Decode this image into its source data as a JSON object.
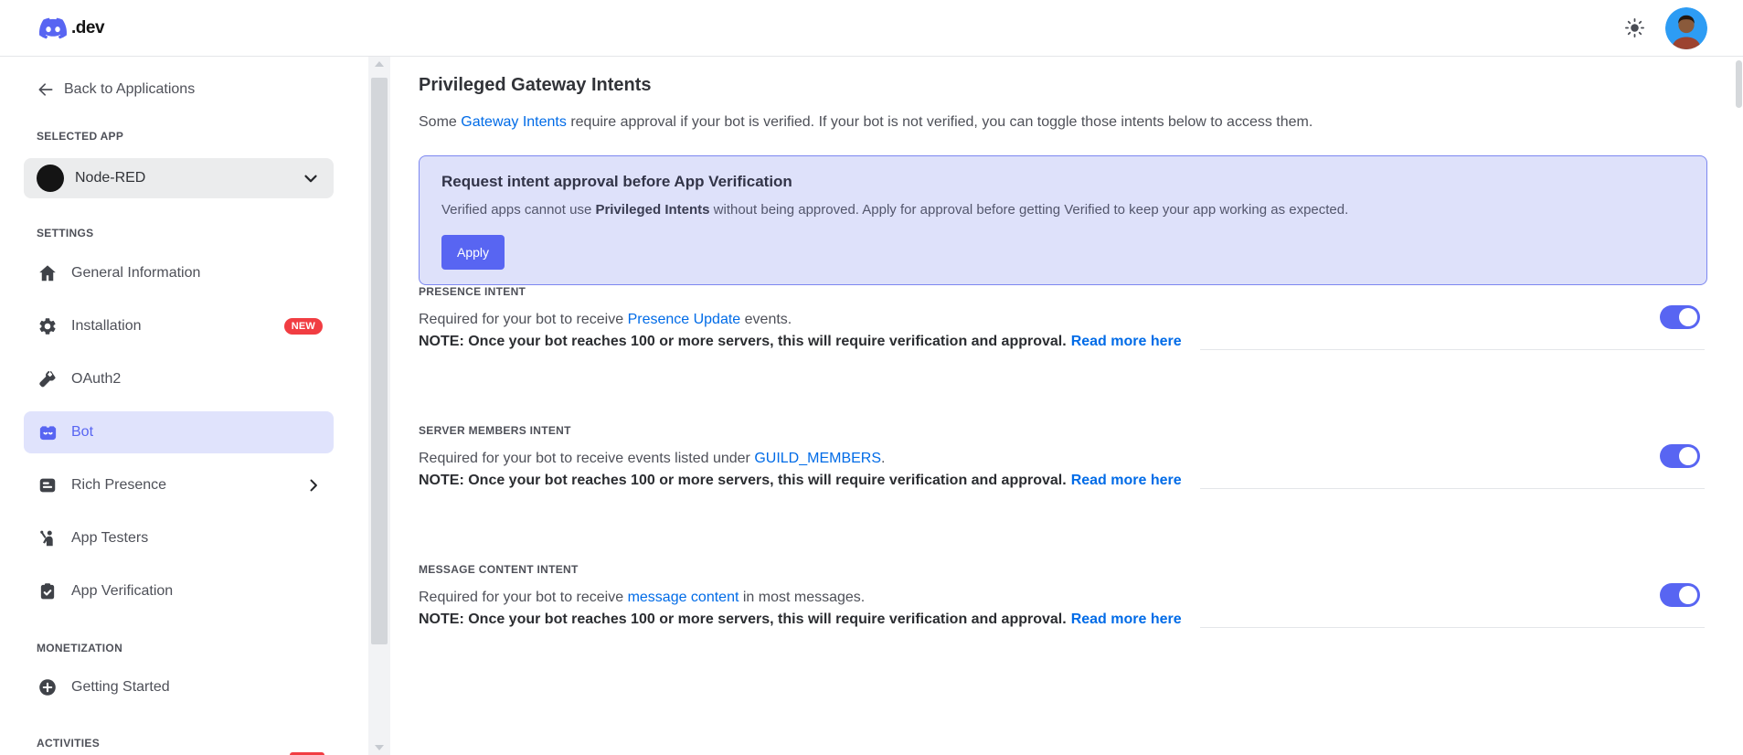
{
  "header": {
    "brand_suffix": ".dev"
  },
  "sidebar": {
    "back_label": "Back to Applications",
    "selected_app_heading": "SELECTED APP",
    "app_name": "Node-RED",
    "settings_heading": "SETTINGS",
    "monetization_heading": "MONETIZATION",
    "activities_heading": "ACTIVITIES",
    "items": [
      {
        "label": "General Information"
      },
      {
        "label": "Installation",
        "badge": "NEW"
      },
      {
        "label": "OAuth2"
      },
      {
        "label": "Bot",
        "selected": true
      },
      {
        "label": "Rich Presence",
        "has_submenu": true
      },
      {
        "label": "App Testers"
      },
      {
        "label": "App Verification"
      },
      {
        "label": "Getting Started"
      }
    ]
  },
  "main": {
    "title": "Privileged Gateway Intents",
    "intro": {
      "pre": "Some ",
      "link": "Gateway Intents",
      "post": " require approval if your bot is verified. If your bot is not verified, you can toggle those intents below to access them."
    },
    "alert": {
      "title": "Request intent approval before App Verification",
      "body_pre": "Verified apps cannot use ",
      "body_bold": "Privileged Intents",
      "body_post": " without being approved. Apply for approval before getting Verified to keep your app working as expected.",
      "button_label": "Apply"
    },
    "intents": [
      {
        "label": "PRESENCE INTENT",
        "desc_pre": "Required for your bot to receive ",
        "desc_link": "Presence Update",
        "desc_post": " events.",
        "note": "NOTE: Once your bot reaches 100 or more servers, this will require verification and approval.",
        "note_link": "Read more here",
        "enabled": true
      },
      {
        "label": "SERVER MEMBERS INTENT",
        "desc_pre": "Required for your bot to receive events listed under ",
        "desc_link": "GUILD_MEMBERS",
        "desc_post": ".",
        "note": "NOTE: Once your bot reaches 100 or more servers, this will require verification and approval.",
        "note_link": "Read more here",
        "enabled": true
      },
      {
        "label": "MESSAGE CONTENT INTENT",
        "desc_pre": "Required for your bot to receive ",
        "desc_link": "message content",
        "desc_post": " in most messages.",
        "note": "NOTE: Once your bot reaches 100 or more servers, this will require verification and approval.",
        "note_link": "Read more here",
        "enabled": true
      }
    ]
  },
  "colors": {
    "accent_blurple": "#5865f2",
    "link_blue": "#006be7",
    "badge_red": "#f13d42",
    "alert_bg": "#dee1fa",
    "alert_border": "#7c87f0",
    "selected_item_bg": "#e0e3fc"
  }
}
